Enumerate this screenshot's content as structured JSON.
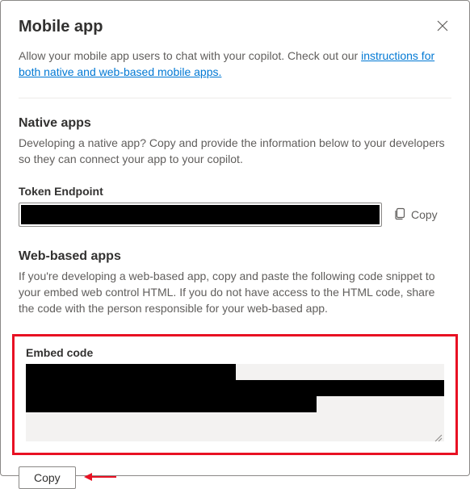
{
  "header": {
    "title": "Mobile app"
  },
  "intro": {
    "text_before_link": "Allow your mobile app users to chat with your copilot. Check out our ",
    "link_text": "instructions for both native and web-based mobile apps.",
    "text_after_link": ""
  },
  "native": {
    "heading": "Native apps",
    "desc": "Developing a native app? Copy and provide the information below to your developers so they can connect your app to your copilot.",
    "token_label": "Token Endpoint",
    "copy_label": "Copy"
  },
  "web": {
    "heading": "Web-based apps",
    "desc": "If you're developing a web-based app, copy and paste the following code snippet to your embed web control HTML. If you do not have access to the HTML code, share the code with the person responsible for your web-based app.",
    "embed_label": "Embed code",
    "copy_button": "Copy"
  }
}
